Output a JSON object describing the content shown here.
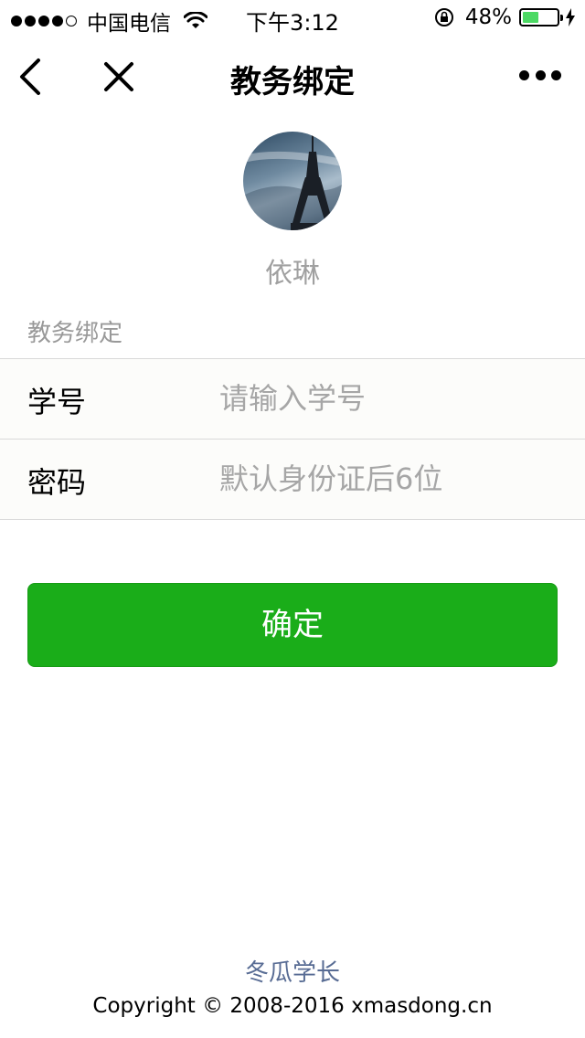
{
  "status_bar": {
    "carrier": "中国电信",
    "time": "下午3:12",
    "battery_percent": "48%",
    "battery_level": 0.48,
    "battery_color": "#4cd964",
    "icons": [
      "signal-dots-icon",
      "wifi-icon",
      "rotation-lock-icon",
      "battery-icon",
      "charging-bolt-icon"
    ]
  },
  "nav": {
    "title": "教务绑定",
    "icons": [
      "back-chevron-icon",
      "close-icon",
      "more-dots-icon"
    ]
  },
  "profile": {
    "name": "依琳"
  },
  "form": {
    "section_label": "教务绑定",
    "student_id_label": "学号",
    "student_id_value": "",
    "student_id_placeholder": "请输入学号",
    "password_label": "密码",
    "password_value": "",
    "password_placeholder": "默认身份证后6位"
  },
  "actions": {
    "confirm_label": "确定",
    "confirm_color": "#1aad19"
  },
  "footer": {
    "link_text": "冬瓜学长",
    "copyright": "Copyright © 2008-2016 xmasdong.cn"
  }
}
